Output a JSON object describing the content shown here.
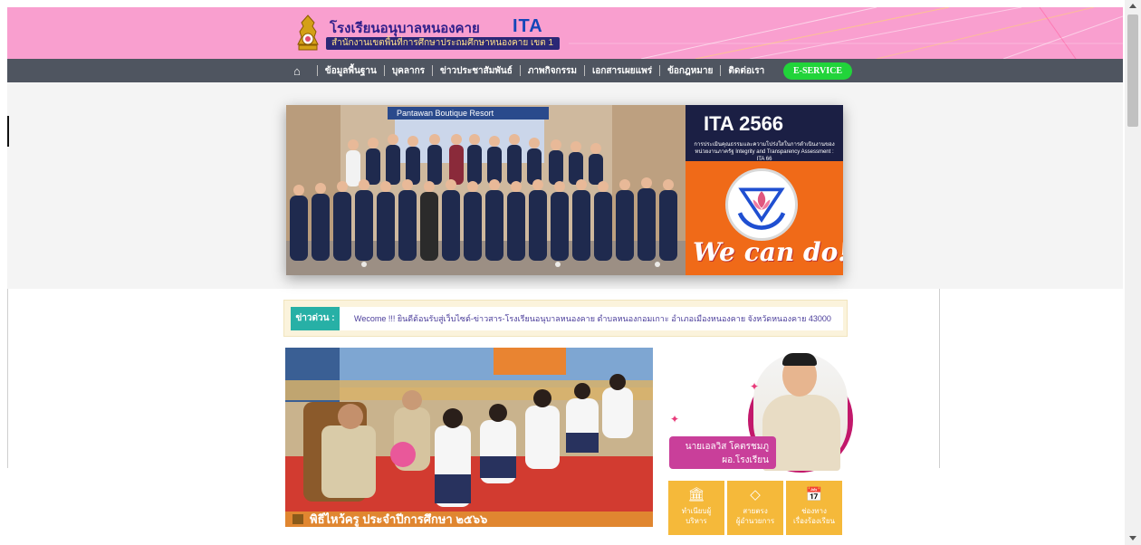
{
  "header": {
    "school_name": "โรงเรียนอนุบาลหนองคาย",
    "office_name": "สำนักงานเขตพื้นที่การศึกษาประถมศึกษาหนองคาย เขต 1",
    "ita_logo": "ITA"
  },
  "nav": {
    "items": [
      {
        "label": "ข้อมูลพื้นฐาน"
      },
      {
        "label": "บุคลากร"
      },
      {
        "label": "ข่าวประชาสัมพันธ์"
      },
      {
        "label": "ภาพกิจกรรม"
      },
      {
        "label": "เอกสารเผยแพร่"
      },
      {
        "label": "ข้อกฎหมาย"
      },
      {
        "label": "ติดต่อเรา"
      }
    ],
    "eservice_label": "E-SERVICE"
  },
  "banner": {
    "sign_text": "Pantawan Boutique Resort",
    "ita_year": "ITA 2566",
    "ita_sub": "การประเมินคุณธรรมและความโปร่งใสในการดำเนินงานของหน่วยงานภาครัฐ Integrity and Transparency Assessment : ITA 66",
    "slogan": "We can do!!"
  },
  "ticker": {
    "label": "ข่าวด่วน :",
    "text": "Wecome !!! ยินดีต้อนรับสู่เว็บไซต์-ข่าวสาร-โรงเรียนอนุบาลหนองคาย ตำบลหนองกอมเกาะ อำเภอเมืองหนองคาย จังหวัดหนองคาย 43000"
  },
  "ceremony": {
    "caption": "พิธีไหว้ครู ประจำปีการศึกษา ๒๕๖๖"
  },
  "director": {
    "name": "นายเอลวิส โคตรชมภู",
    "position": "ผอ.โรงเรียน"
  },
  "services": [
    {
      "icon": "bank-icon",
      "label_1": "ทำเนียบผู้",
      "label_2": "บริหาร"
    },
    {
      "icon": "diamond-icon",
      "label_1": "สายตรง",
      "label_2": "ผู้อำนวยการ"
    },
    {
      "icon": "calendar-icon",
      "label_1": "ช่องทาง",
      "label_2": "เรื่องร้องเรียน"
    }
  ],
  "colors": {
    "header_pink": "#f99fcf",
    "nav_gray": "#4f5560",
    "eservice_green": "#21d43a",
    "ticker_teal": "#27b0a6",
    "service_yellow": "#f5b93a",
    "director_magenta": "#c2186b"
  }
}
